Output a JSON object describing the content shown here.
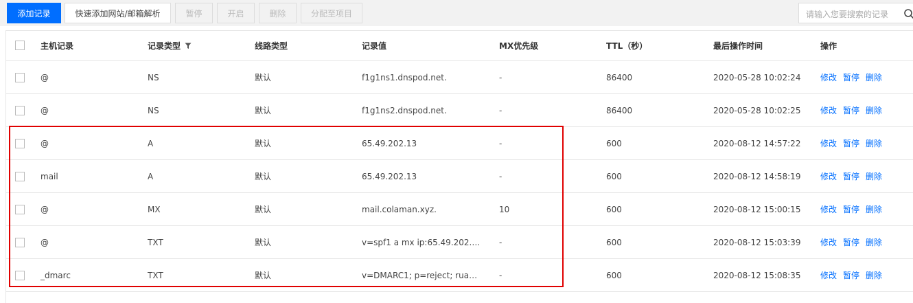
{
  "toolbar": {
    "add_record": "添加记录",
    "quick_add": "快速添加网站/邮箱解析",
    "pause": "暂停",
    "enable": "开启",
    "delete": "删除",
    "assign_project": "分配至项目",
    "search_placeholder": "请输入您要搜索的记录"
  },
  "table": {
    "columns": [
      "主机记录",
      "记录类型",
      "线路类型",
      "记录值",
      "MX优先级",
      "TTL（秒）",
      "最后操作时间",
      "操作"
    ],
    "actions": [
      "修改",
      "暂停",
      "删除"
    ],
    "rows": [
      {
        "host": "@",
        "type": "NS",
        "line": "默认",
        "value": "f1g1ns1.dnspod.net.",
        "mx": "-",
        "ttl": "86400",
        "time": "2020-05-28 10:02:24"
      },
      {
        "host": "@",
        "type": "NS",
        "line": "默认",
        "value": "f1g1ns2.dnspod.net.",
        "mx": "-",
        "ttl": "86400",
        "time": "2020-05-28 10:02:25"
      },
      {
        "host": "@",
        "type": "A",
        "line": "默认",
        "value": "65.49.202.13",
        "mx": "-",
        "ttl": "600",
        "time": "2020-08-12 14:57:22"
      },
      {
        "host": "mail",
        "type": "A",
        "line": "默认",
        "value": "65.49.202.13",
        "mx": "-",
        "ttl": "600",
        "time": "2020-08-12 14:58:19"
      },
      {
        "host": "@",
        "type": "MX",
        "line": "默认",
        "value": "mail.colaman.xyz.",
        "mx": "10",
        "ttl": "600",
        "time": "2020-08-12 15:00:15"
      },
      {
        "host": "@",
        "type": "TXT",
        "line": "默认",
        "value": "v=spf1 a mx ip:65.49.202.…",
        "mx": "-",
        "ttl": "600",
        "time": "2020-08-12 15:03:39"
      },
      {
        "host": "_dmarc",
        "type": "TXT",
        "line": "默认",
        "value": "v=DMARC1; p=reject; rua…",
        "mx": "-",
        "ttl": "600",
        "time": "2020-08-12 15:08:35"
      }
    ]
  },
  "colors": {
    "accent": "#006eff",
    "highlight": "#e00000"
  },
  "icons": {
    "search": "search-icon",
    "filter": "filter-icon"
  }
}
